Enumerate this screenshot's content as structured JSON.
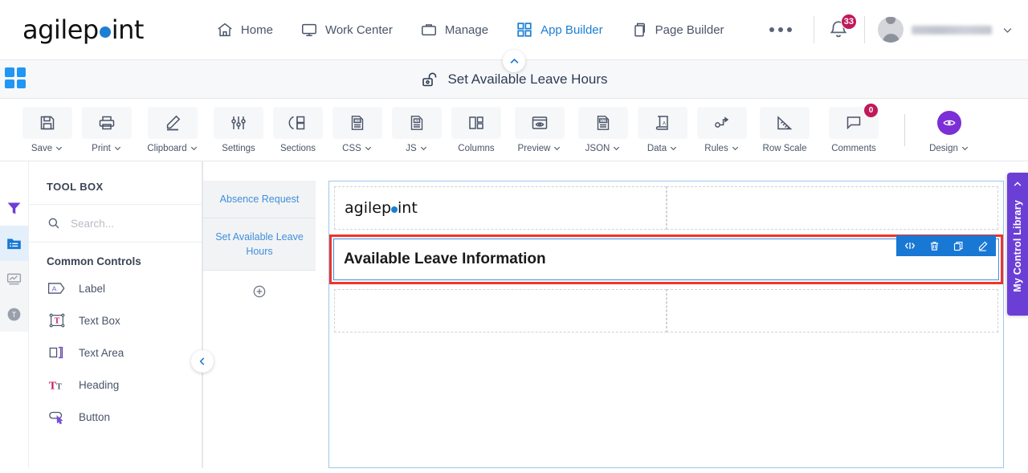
{
  "brand": {
    "name_part1": "agilep",
    "name_part2": "int",
    "dot_color": "#1b7fd4"
  },
  "topnav": {
    "items": [
      {
        "label": "Home",
        "icon": "home-icon",
        "active": false
      },
      {
        "label": "Work Center",
        "icon": "monitor-icon",
        "active": false
      },
      {
        "label": "Manage",
        "icon": "briefcase-icon",
        "active": false
      },
      {
        "label": "App Builder",
        "icon": "grid-icon",
        "active": true
      },
      {
        "label": "Page Builder",
        "icon": "pages-icon",
        "active": false
      }
    ],
    "overflow": "more-options-icon",
    "notifications": {
      "count": "33",
      "icon": "bell-icon",
      "color": "#c2185b"
    },
    "user": {
      "name": "",
      "icon": "avatar",
      "caret": "chevron-down-icon"
    }
  },
  "titlebar": {
    "title": "Set Available Leave Hours",
    "lock_icon": "unlock-icon",
    "grid_icon": "app-grid-icon",
    "collapse_icon": "chevron-up-icon"
  },
  "toolbar": {
    "items": [
      {
        "label": "Save",
        "icon": "save-icon",
        "caret": true
      },
      {
        "label": "Print",
        "icon": "print-icon",
        "caret": true
      },
      {
        "label": "Clipboard",
        "icon": "pencil-icon",
        "caret": true
      },
      {
        "label": "Settings",
        "icon": "sliders-icon",
        "caret": false
      },
      {
        "label": "Sections",
        "icon": "sections-icon",
        "caret": false
      },
      {
        "label": "CSS",
        "icon": "css-file-icon",
        "caret": true
      },
      {
        "label": "JS",
        "icon": "js-file-icon",
        "caret": true
      },
      {
        "label": "Columns",
        "icon": "columns-icon",
        "caret": false
      },
      {
        "label": "Preview",
        "icon": "eye-window-icon",
        "caret": true
      },
      {
        "label": "JSON",
        "icon": "json-file-icon",
        "caret": true
      },
      {
        "label": "Data",
        "icon": "data-book-icon",
        "caret": true
      },
      {
        "label": "Rules",
        "icon": "rules-flow-icon",
        "caret": false,
        "caret2": true
      },
      {
        "label": "Row Scale",
        "icon": "ruler-icon",
        "caret": false
      },
      {
        "label": "Comments",
        "icon": "comment-icon",
        "caret": false,
        "badge": "0"
      }
    ],
    "design": {
      "label": "Design",
      "icon": "eye-circle-icon",
      "caret": true,
      "color": "#7b2fd4"
    }
  },
  "rail": {
    "items": [
      {
        "name": "filter-icon",
        "active": false,
        "color": "#6b3fd6"
      },
      {
        "name": "folder-list-icon",
        "active": true,
        "color": "#1878d4"
      },
      {
        "name": "chart-icon",
        "active": false,
        "color": "#9aa0ab"
      },
      {
        "name": "text-circle-icon",
        "active": false,
        "color": "#9aa0ab"
      }
    ]
  },
  "toolbox": {
    "title": "TOOL BOX",
    "search": {
      "placeholder": "Search...",
      "value": "",
      "icon": "search-icon"
    },
    "group_label": "Common Controls",
    "controls": [
      {
        "label": "Label",
        "icon": "label-tag-icon"
      },
      {
        "label": "Text Box",
        "icon": "text-box-icon"
      },
      {
        "label": "Text Area",
        "icon": "text-area-icon"
      },
      {
        "label": "Heading",
        "icon": "heading-icon"
      },
      {
        "label": "Button",
        "icon": "button-icon"
      }
    ],
    "collapse_icon": "chevron-left-icon"
  },
  "page_tabs": {
    "tabs": [
      {
        "label": "Absence Request",
        "active": false
      },
      {
        "label": "Set Available Leave Hours",
        "active": true
      }
    ],
    "add_icon": "add-circle-icon"
  },
  "canvas": {
    "logo_part1": "agilep",
    "logo_part2": "int",
    "selected_row": {
      "heading": "Available Leave Information",
      "border_color": "#f0342a",
      "toolbar": [
        {
          "name": "move-handle-icon",
          "glyph": "‹|›"
        },
        {
          "name": "delete-icon",
          "glyph": "trash"
        },
        {
          "name": "duplicate-icon",
          "glyph": "copy"
        },
        {
          "name": "edit-icon",
          "glyph": "pencil"
        }
      ]
    }
  },
  "control_library": {
    "label": "My Control Library",
    "chevron": "chevron-left-icon",
    "color": "#6b3fd6"
  }
}
